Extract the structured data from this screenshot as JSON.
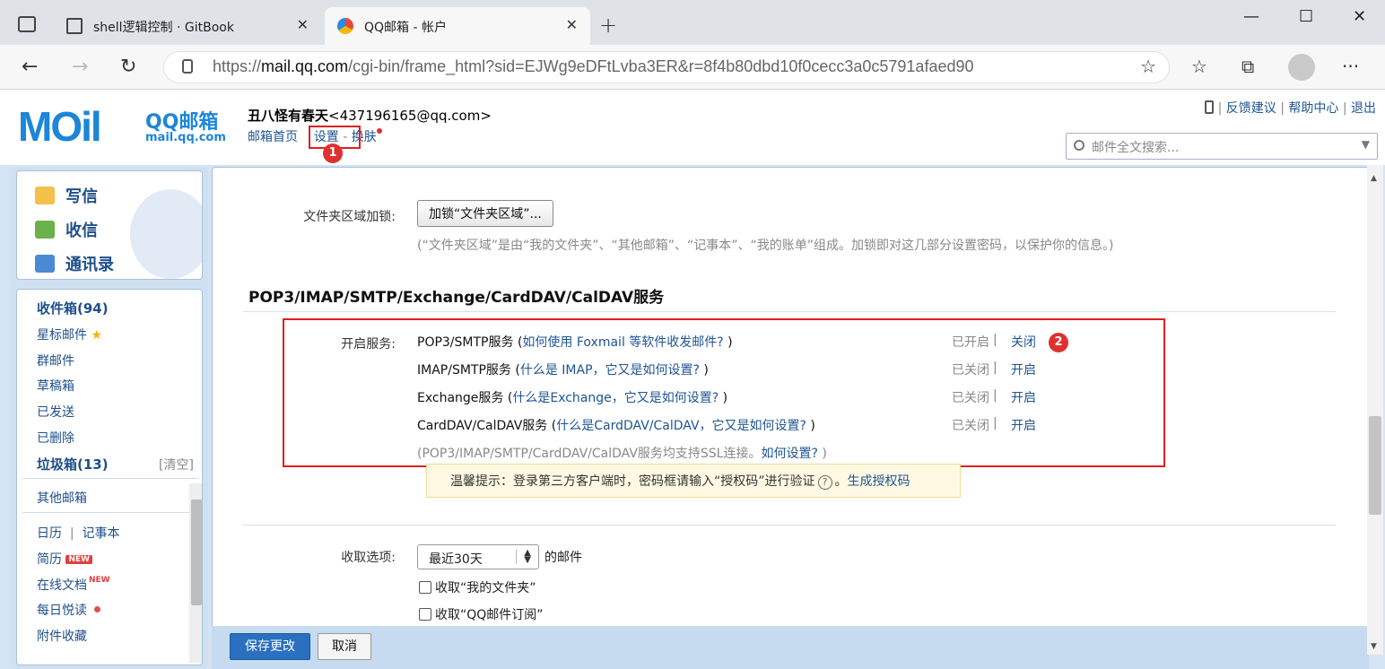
{
  "browser": {
    "tabs": [
      {
        "label": "shell逻辑控制 · GitBook",
        "icon": "book-icon"
      },
      {
        "label": "QQ邮箱 - 帐户",
        "icon": "qq-browser-icon"
      }
    ],
    "url_prefix": "https://",
    "url_host": "mail.qq.com",
    "url_path": "/cgi-bin/frame_html?sid=EJWg9eDFtLvba3ER&r=8f4b80dbd10f0cecc3a0c5791afaed90",
    "new_tab": "+",
    "close": "✕"
  },
  "header": {
    "logo_text": "QQ邮箱",
    "logo_sub": "mail.qq.com",
    "logo_mark": "MOil",
    "user_name": "丑八怪有春天",
    "user_email": "<437196165@qq.com>",
    "nav_home": "邮箱首页",
    "nav_settings": "设置",
    "nav_sep": "-",
    "nav_skin": "换肤",
    "link_feedback": "反馈建议",
    "link_help": "帮助中心",
    "link_logout": "退出",
    "search_placeholder": "邮件全文搜索..."
  },
  "sidebar": {
    "quick": [
      {
        "label": "写信",
        "icon": "compose-icon"
      },
      {
        "label": "收信",
        "icon": "inbox-download-icon"
      },
      {
        "label": "通讯录",
        "icon": "contacts-icon"
      }
    ],
    "inbox": "收件箱(94)",
    "starred": "星标邮件",
    "group": "群邮件",
    "drafts": "草稿箱",
    "sent": "已发送",
    "deleted": "已删除",
    "spam": "垃圾箱(13)",
    "spam_clear": "[清空]",
    "other_mail": "其他邮箱",
    "calendar": "日历",
    "notes": "记事本",
    "resume": "简历",
    "online_docs": "在线文档",
    "daily_reading": "每日悦读",
    "attachments": "附件收藏",
    "new_badge": "NEW"
  },
  "settings": {
    "folder_lock_label": "文件夹区域加锁:",
    "folder_lock_button": "加锁“文件夹区域”...",
    "folder_lock_desc": "(“文件夹区域”是由“我的文件夹”、“其他邮箱”、“记事本”、“我的账单”组成。加锁即对这几部分设置密码，以保护你的信息。)",
    "service_title": "POP3/IMAP/SMTP/Exchange/CardDAV/CalDAV服务",
    "enable_label": "开启服务:",
    "services": [
      {
        "name": "POP3/SMTP服务",
        "help": "如何使用 Foxmail 等软件收发邮件?",
        "status": "已开启",
        "action": "关闭"
      },
      {
        "name": "IMAP/SMTP服务",
        "help": "什么是 IMAP，它又是如何设置?",
        "status": "已关闭",
        "action": "开启"
      },
      {
        "name": "Exchange服务",
        "help": "什么是Exchange，它又是如何设置?",
        "status": "已关闭",
        "action": "开启"
      },
      {
        "name": "CardDAV/CalDAV服务",
        "help": "什么是CardDAV/CalDAV，它又是如何设置?",
        "status": "已关闭",
        "action": "开启"
      }
    ],
    "ssl_note": "(POP3/IMAP/SMTP/CardDAV/CalDAV服务均支持SSL连接。",
    "ssl_link": "如何设置?",
    "tip_text": "温馨提示：登录第三方客户端时，密码框请输入“授权码”进行验证",
    "tip_link": "生成授权码",
    "receive_label": "收取选项:",
    "receive_select": "最近30天",
    "receive_suffix": "的邮件",
    "receive_opt1": "收取“我的文件夹”",
    "receive_opt2": "收取“QQ邮件订阅”",
    "save_button": "保存更改",
    "cancel_button": "取消"
  },
  "annotations": {
    "badge1": "1",
    "badge2": "2",
    "color": "#e02020"
  }
}
